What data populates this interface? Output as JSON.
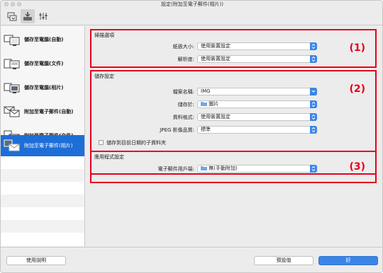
{
  "window": {
    "title": "設定(附加至電子郵件(相片))"
  },
  "toolbar": {
    "tabs": [
      {
        "name": "scan-tab-icon",
        "active": false
      },
      {
        "name": "scanner-tab-icon",
        "active": true
      },
      {
        "name": "general-settings-tab-icon",
        "active": false
      }
    ]
  },
  "sidebar": {
    "items": [
      {
        "label": "儲存至電腦(自動)",
        "icon": "computer-auto-icon"
      },
      {
        "label": "儲存至電腦(文件)",
        "icon": "computer-document-icon"
      },
      {
        "label": "儲存至電腦(相片)",
        "icon": "computer-photo-icon"
      },
      {
        "label": "附加至電子郵件(自動)",
        "icon": "email-auto-icon"
      },
      {
        "label": "附加至電子郵件(文件)",
        "icon": "email-document-icon"
      },
      {
        "label": "附加至電子郵件(相片)",
        "icon": "email-photo-icon",
        "selected": true
      }
    ]
  },
  "scan_options": {
    "title": "掃描選項",
    "number": "(1)",
    "paper_size_label": "紙張大小:",
    "paper_size_value": "使用裝置設定",
    "resolution_label": "解析度:",
    "resolution_value": "使用裝置設定"
  },
  "save_settings": {
    "title": "儲存設定",
    "number": "(2)",
    "file_name_label": "檔案名稱:",
    "file_name_value": "IMG",
    "save_in_label": "儲存於:",
    "save_in_value": "圖片",
    "data_format_label": "資料格式:",
    "data_format_value": "使用裝置設定",
    "jpeg_quality_label": "JPEG 影像品質:",
    "jpeg_quality_value": "標準",
    "subfolder_label": "儲存到目前日期的子資料夾",
    "subfolder_checked": false
  },
  "app_settings": {
    "title": "應用程式設定",
    "number": "(3)",
    "email_client_label": "電子郵件用戶端:",
    "email_client_value": "無(手動附加)"
  },
  "footer": {
    "help_label": "使用說明",
    "defaults_label": "預設值",
    "ok_label": "好"
  },
  "colors": {
    "accent": "#3b85e6",
    "highlight": "#e8001c",
    "selected": "#1e6ed8"
  }
}
